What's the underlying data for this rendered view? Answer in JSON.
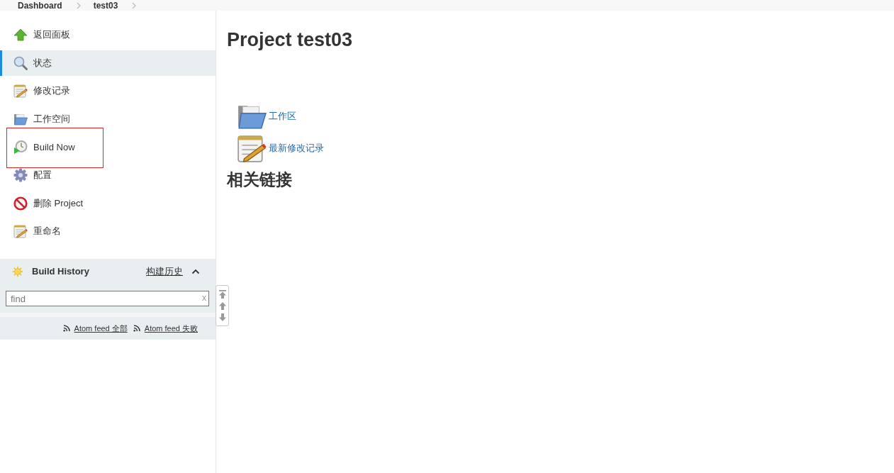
{
  "breadcrumb": [
    {
      "label": "Dashboard"
    },
    {
      "label": "test03"
    }
  ],
  "sidebar": {
    "items": [
      {
        "label": "返回面板",
        "selected": false,
        "highlighted": false
      },
      {
        "label": "状态",
        "selected": true,
        "highlighted": false
      },
      {
        "label": "修改记录",
        "selected": false,
        "highlighted": false
      },
      {
        "label": "工作空间",
        "selected": false,
        "highlighted": false
      },
      {
        "label": "Build Now",
        "selected": false,
        "highlighted": true
      },
      {
        "label": "配置",
        "selected": false,
        "highlighted": false
      },
      {
        "label": "删除 Project",
        "selected": false,
        "highlighted": false
      },
      {
        "label": "重命名",
        "selected": false,
        "highlighted": false
      }
    ]
  },
  "build_history": {
    "title": "Build History",
    "link": "构建历史",
    "expanded": true,
    "search": {
      "placeholder": "find",
      "clear": "x"
    },
    "feeds": [
      {
        "label": "Atom feed 全部"
      },
      {
        "label": "Atom feed 失败"
      }
    ]
  },
  "main": {
    "title": "Project test03",
    "links": [
      {
        "label": "工作区"
      },
      {
        "label": "最新修改记录"
      }
    ],
    "section_title": "相关链接"
  }
}
